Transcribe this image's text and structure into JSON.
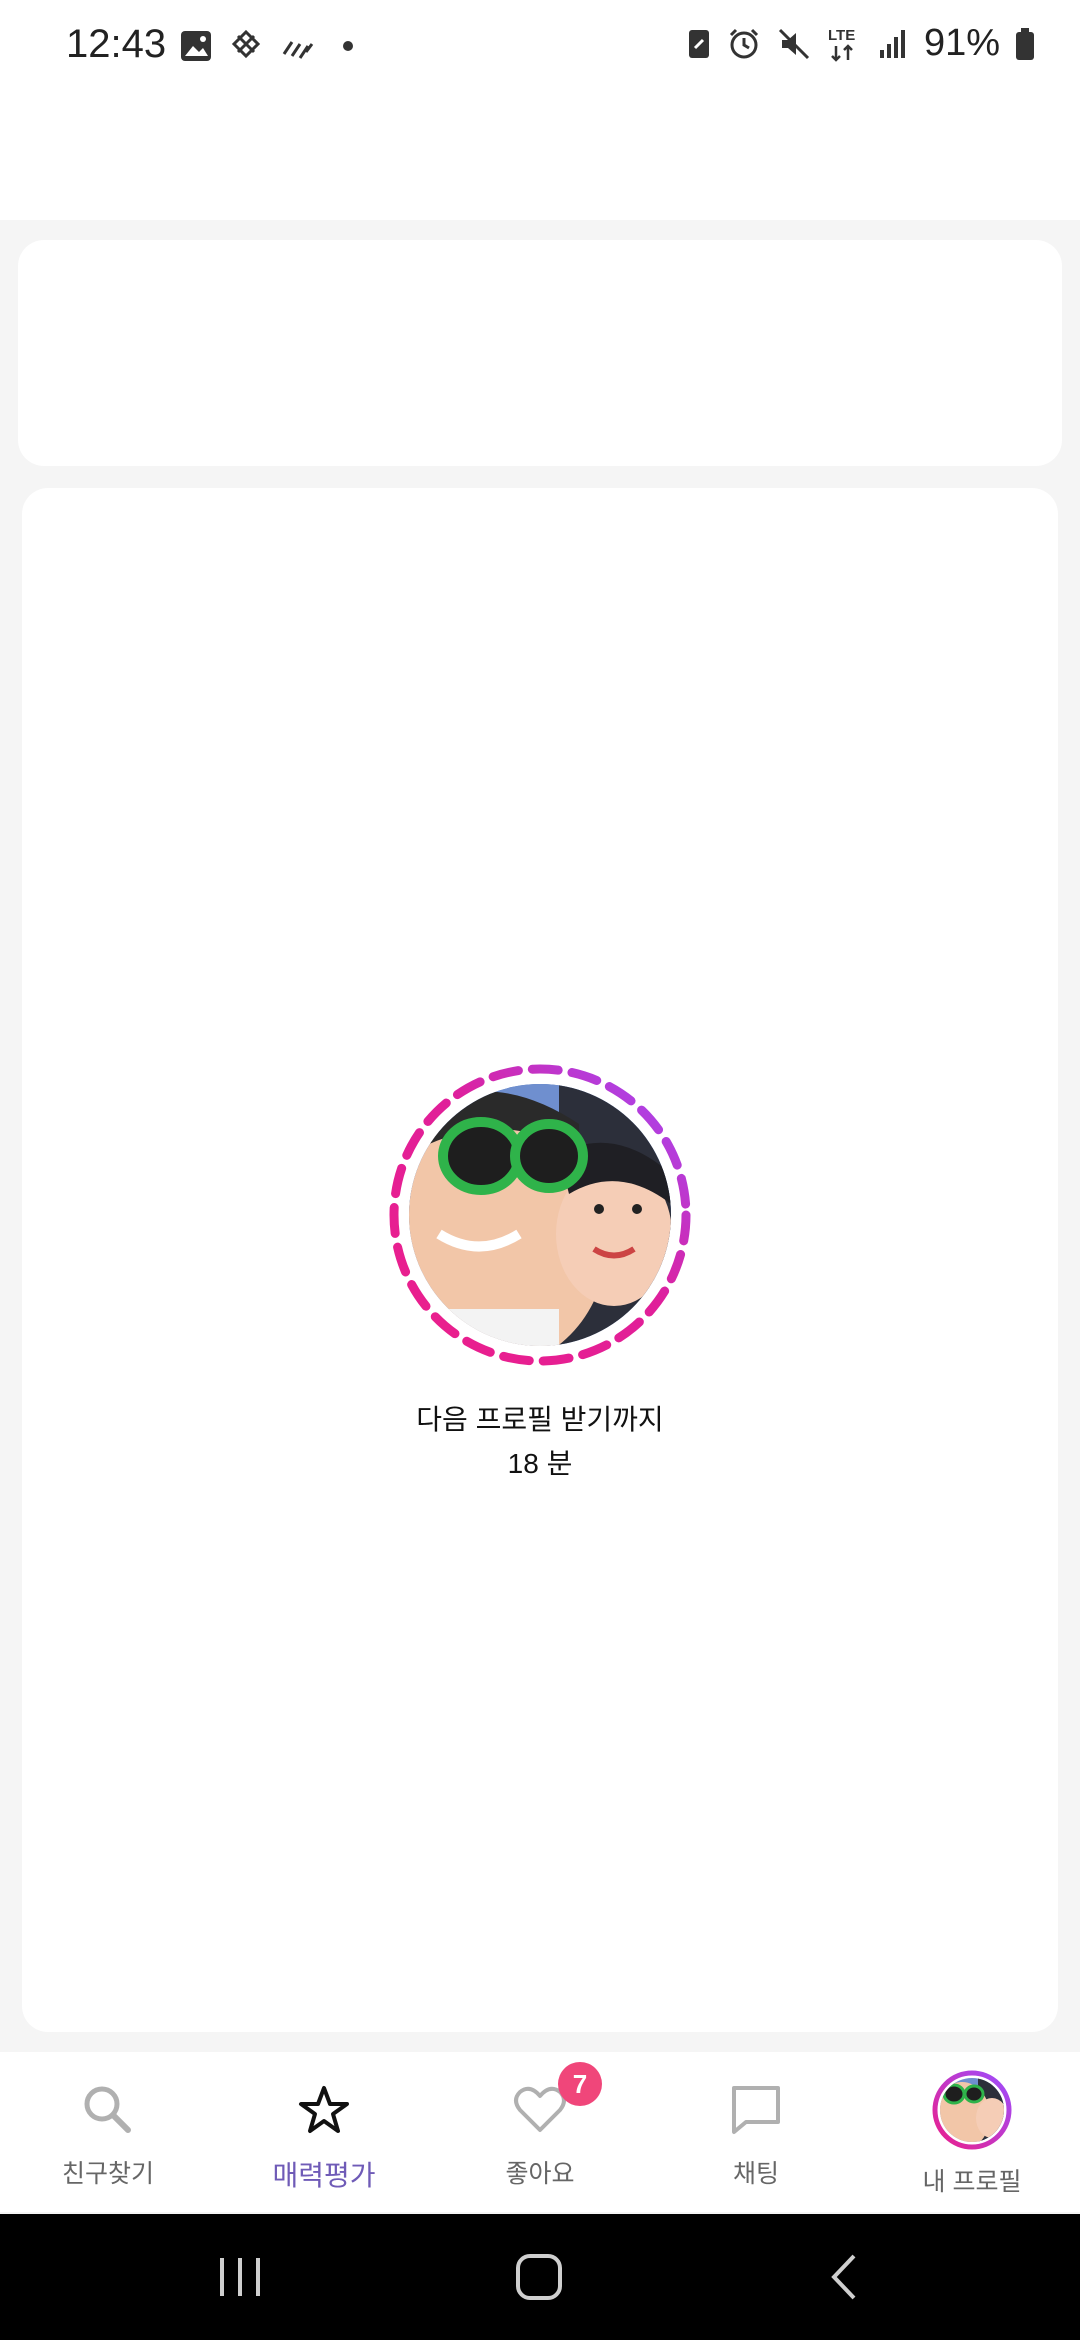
{
  "status_bar": {
    "time": "12:43",
    "battery": "91%",
    "left_icons": [
      "image-icon",
      "pinwheel-icon",
      "rain-icon",
      "dot-icon"
    ],
    "right_icons": [
      "battery-saver-icon",
      "alarm-icon",
      "mute-icon",
      "lte-icon",
      "signal-icon",
      "battery-icon"
    ]
  },
  "wait": {
    "line1": "다음 프로필 받기까지",
    "line2": "18 분"
  },
  "bottom_nav": {
    "items": [
      {
        "label": "친구찾기",
        "icon": "search-icon"
      },
      {
        "label": "매력평가",
        "icon": "star-icon"
      },
      {
        "label": "좋아요",
        "icon": "heart-icon",
        "badge": "7"
      },
      {
        "label": "채팅",
        "icon": "chat-icon"
      },
      {
        "label": "내 프로필",
        "icon": "profile-avatar-icon"
      }
    ]
  },
  "colors": {
    "active": "#6f5bb7",
    "badge": "#f0467a",
    "ring_pink": "#ec1f8a",
    "ring_purple": "#9c4dff"
  }
}
